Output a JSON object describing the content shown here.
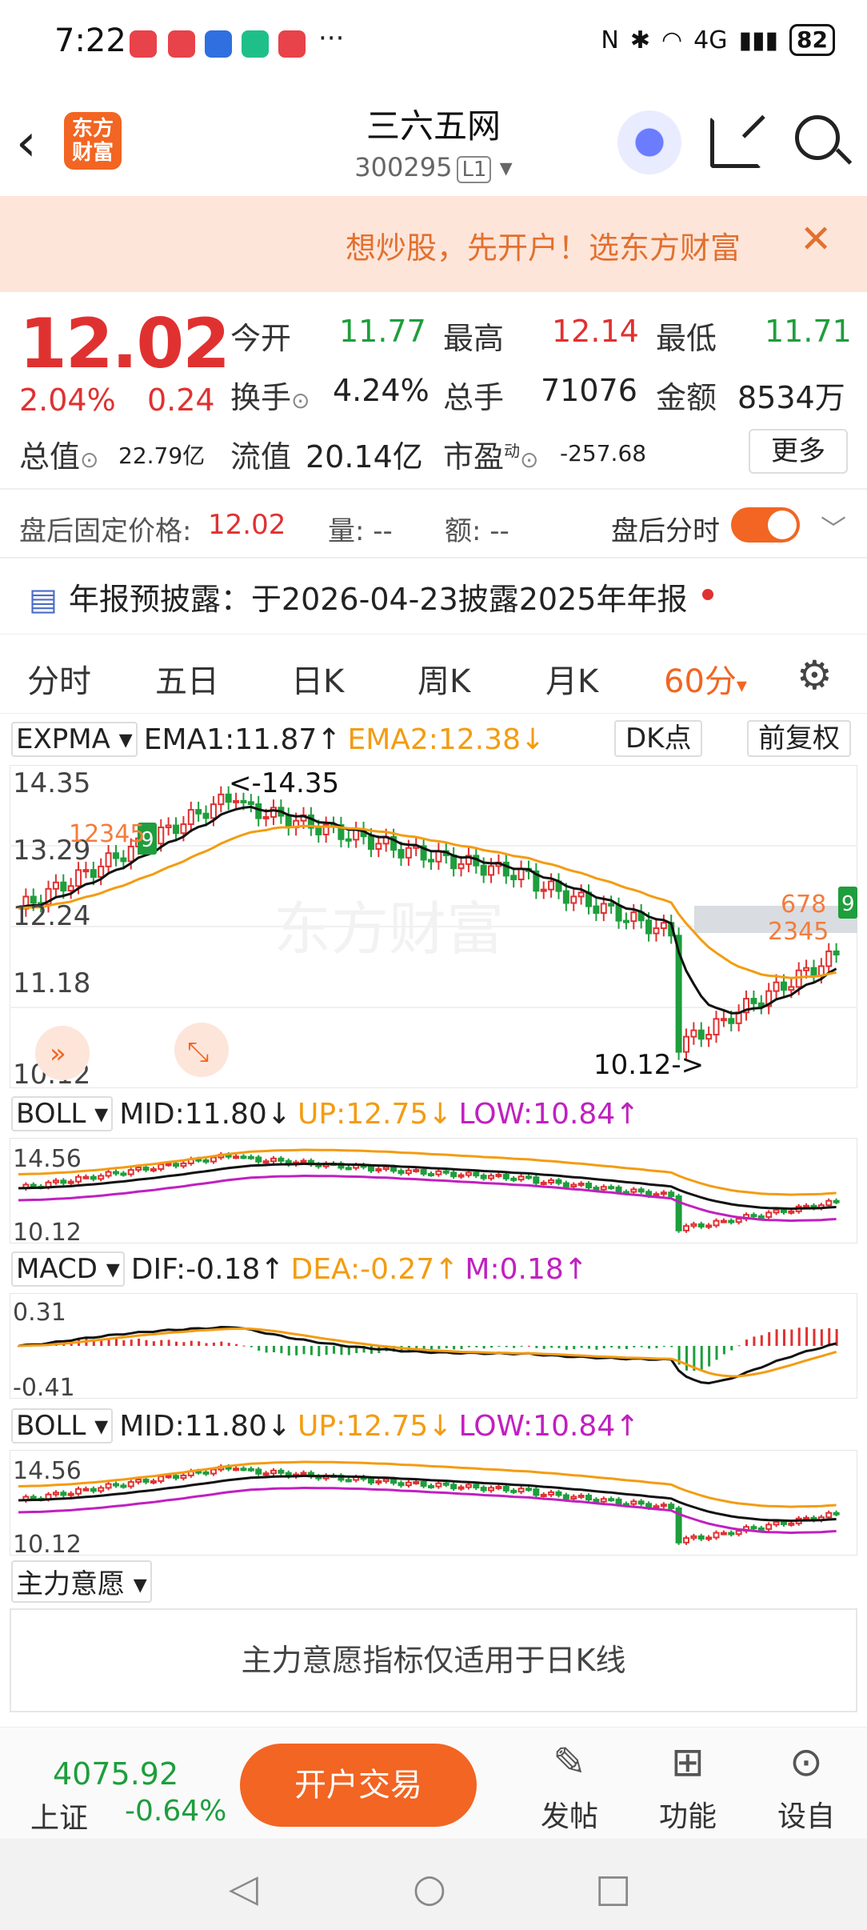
{
  "status": {
    "time": "7:22",
    "more": "···",
    "battery": "82",
    "network": "4G"
  },
  "header": {
    "title": "三六五网",
    "code": "300295",
    "level": "L1",
    "logo_text_1": "东方",
    "logo_text_2": "财富"
  },
  "promo": {
    "text": "想炒股，先开户！选东方财富",
    "close": "✕"
  },
  "quote": {
    "price": "12.02",
    "pct": "2.04%",
    "change": "0.24",
    "open_label": "今开",
    "open": "11.77",
    "high_label": "最高",
    "high": "12.14",
    "low_label": "最低",
    "low": "11.71",
    "turnover_label": "换手",
    "turnover": "4.24%",
    "volume_label": "总手",
    "volume": "71076",
    "amount_label": "金额",
    "amount": "8534万",
    "mktcap_label": "总值",
    "mktcap": "22.79亿",
    "float_label": "流值",
    "float": "20.14亿",
    "pe_label": "市盈",
    "pe_sup": "动",
    "pe": "-257.68",
    "more": "更多"
  },
  "after_hours": {
    "price_label": "盘后固定价格:",
    "price": "12.02",
    "vol_label": "量: --",
    "amt_label": "额: --",
    "toggle_label": "盘后分时"
  },
  "notice": {
    "text": "年报预披露：于2026-04-23披露2025年年报"
  },
  "tabs": [
    "分时",
    "五日",
    "日K",
    "周K",
    "月K",
    "60分"
  ],
  "tab_active_arrow": "▾",
  "indicators": {
    "expma": {
      "name": "EXPMA",
      "ema1": "EMA1:11.87↑",
      "ema2": "EMA2:12.38↓",
      "dk": "DK点",
      "fq": "前复权",
      "max_label": "<-14.35",
      "min_label": "10.12->",
      "ticks": [
        "14.35",
        "13.29",
        "12.24",
        "11.18",
        "10.12"
      ],
      "watermark": "东方财富"
    },
    "boll1": {
      "name": "BOLL",
      "mid": "MID:11.80↓",
      "up": "UP:12.75↓",
      "low": "LOW:10.84↑",
      "ticks": [
        "14.56",
        "10.12"
      ]
    },
    "macd": {
      "name": "MACD",
      "dif": "DIF:-0.18↑",
      "dea": "DEA:-0.27↑",
      "m": "M:0.18↑",
      "ticks": [
        "0.31",
        "-0.41"
      ]
    },
    "boll2": {
      "name": "BOLL",
      "mid": "MID:11.80↓",
      "up": "UP:12.75↓",
      "low": "LOW:10.84↑",
      "ticks": [
        "14.56",
        "10.12"
      ]
    },
    "zlyy": {
      "name": "主力意愿",
      "note": "主力意愿指标仅适用于日K线"
    }
  },
  "bottom": {
    "index_value": "4075.92",
    "index_name": "上证",
    "index_pct": "-0.64%",
    "trade": "开户交易",
    "post": "发帖",
    "func": "功能",
    "custom": "设自选"
  },
  "colors": {
    "accent": "#f26522",
    "up": "#e03131",
    "down": "#1e9e3c"
  }
}
